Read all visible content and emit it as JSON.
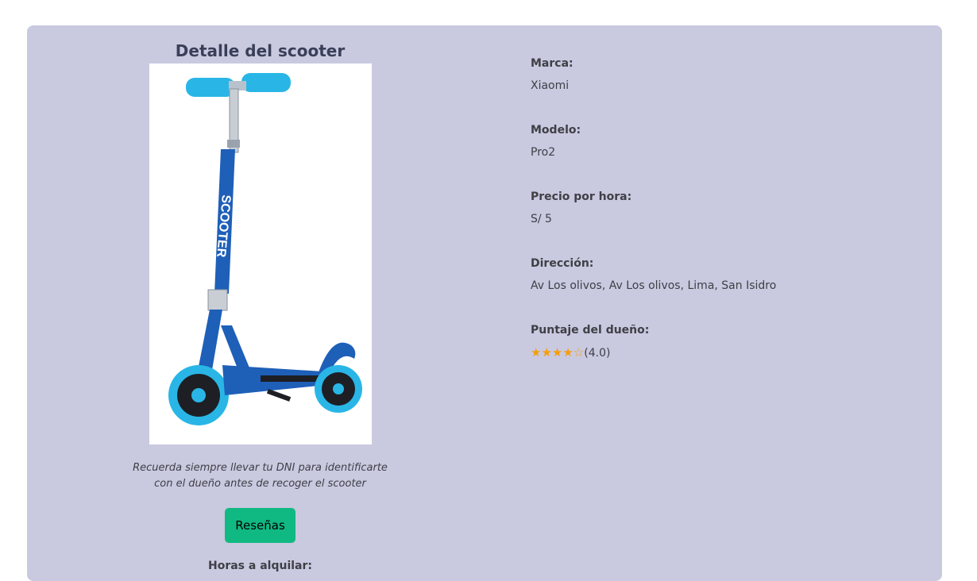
{
  "detail": {
    "title": "Detalle del scooter",
    "image_alt": "scooter-photo",
    "note_line1": "Recuerda siempre llevar tu DNI para identificarte",
    "note_line2": "con el dueño antes de recoger el scooter",
    "reviews_button": "Reseñas",
    "hours_label": "Horas a alquilar:"
  },
  "info": {
    "brand_label": "Marca:",
    "brand_value": "Xiaomi",
    "model_label": "Modelo:",
    "model_value": "Pro2",
    "price_label": "Precio por hora:",
    "price_value": "S/ 5",
    "address_label": "Dirección:",
    "address_value": "Av Los olivos, Av Los olivos, Lima, San Isidro",
    "owner_score_label": "Puntaje del dueño:",
    "owner_stars": "★★★★☆",
    "owner_score_text": "(4.0)",
    "owner_score": 4.0,
    "owner_score_max": 5
  },
  "colors": {
    "panel_bg": "#c9c9e0",
    "button_bg": "#10b981",
    "star_color": "#f59e0b",
    "scooter_blue": "#1e5fb8",
    "wheel_cyan": "#29b6e6"
  }
}
